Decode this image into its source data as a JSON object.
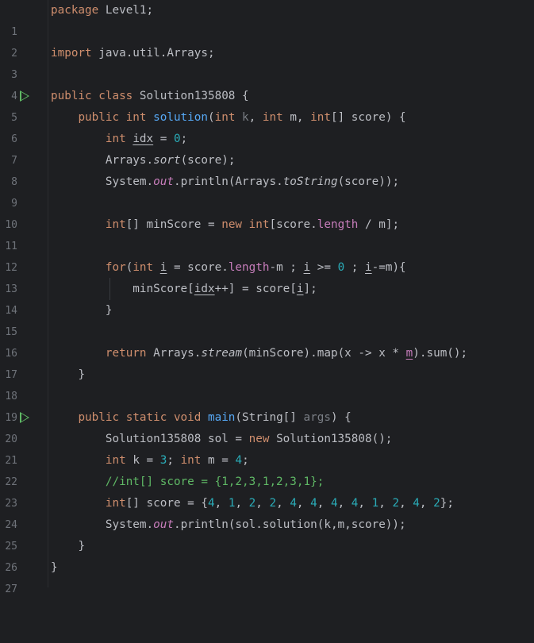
{
  "editor": {
    "lines": [
      {
        "n": "1"
      },
      {
        "n": "2"
      },
      {
        "n": "3"
      },
      {
        "n": "4"
      },
      {
        "n": "5"
      },
      {
        "n": "6"
      },
      {
        "n": "7"
      },
      {
        "n": "8"
      },
      {
        "n": "9"
      },
      {
        "n": "10"
      },
      {
        "n": "11"
      },
      {
        "n": "12"
      },
      {
        "n": "13"
      },
      {
        "n": "14"
      },
      {
        "n": "15"
      },
      {
        "n": "16"
      },
      {
        "n": "17"
      },
      {
        "n": "18"
      },
      {
        "n": "19"
      },
      {
        "n": "20"
      },
      {
        "n": "21"
      },
      {
        "n": "22"
      },
      {
        "n": "23"
      },
      {
        "n": "24"
      },
      {
        "n": "25"
      },
      {
        "n": "26"
      },
      {
        "n": "27"
      }
    ],
    "code": {
      "l1": {
        "kw": "package",
        "rest": " Level1;"
      },
      "l3": {
        "kw": "import",
        "rest": " java.util.Arrays;"
      },
      "l5": {
        "kw": "public class",
        "rest": " Solution135808 {"
      },
      "l6": {
        "kw1": "public int ",
        "fn": "solution",
        "p1": "(",
        "kw2": "int ",
        "p2": "k",
        ", ": "",
        "sep1": ", ",
        "kw3": "int ",
        "p3": "m, ",
        "kw4": "int",
        "p4": "[] score) {"
      },
      "l7": {
        "kw": "int ",
        "var": "idx",
        "eq": " = ",
        "num": "0",
        "end": ";"
      },
      "l8": {
        "a": "Arrays.",
        "m": "sort",
        "b": "(score);"
      },
      "l9": {
        "a": "System.",
        "f": "out",
        "b": ".println(Arrays.",
        "m": "toString",
        "c": "(score));"
      },
      "l11": {
        "kw": "int",
        "a": "[] minScore = ",
        "kw2": "new ",
        "kw3": "int",
        "b": "[score.",
        "f": "length",
        "c": " / m];"
      },
      "l13": {
        "kw": "for",
        "a": "(",
        "kw2": "int ",
        "v1": "i",
        "b": " = score.",
        "f": "length",
        "c": "-m ; ",
        "v2": "i",
        "d": " >= ",
        "num": "0",
        "e": " ; ",
        "v3": "i",
        "g": "-=m){"
      },
      "l14": {
        "a": "minScore[",
        "v1": "idx",
        "b": "++] = score[",
        "v2": "i",
        "c": "];"
      },
      "l15": {
        "a": "}"
      },
      "l17": {
        "kw": "return ",
        "a": "Arrays.",
        "m": "stream",
        "b": "(minScore).map(x -> x * ",
        "v": "m",
        "c": ").sum();"
      },
      "l18": {
        "a": "}"
      },
      "l20": {
        "kw": "public static void ",
        "fn": "main",
        "a": "(String[] ",
        "p": "args",
        "b": ") {"
      },
      "l21": {
        "a": "Solution135808 sol = ",
        "kw": "new ",
        "b": "Solution135808();"
      },
      "l22": {
        "kw1": "int ",
        "a": "k = ",
        "n1": "3",
        "b": "; ",
        "kw2": "int ",
        "c": "m = ",
        "n2": "4",
        "d": ";"
      },
      "l23": {
        "comment": "//int[] score = {1,2,3,1,2,3,1};"
      },
      "l24": {
        "kw": "int",
        "a": "[] score = {",
        "nums": [
          "4",
          "1",
          "2",
          "2",
          "4",
          "4",
          "4",
          "4",
          "1",
          "2",
          "4",
          "2"
        ],
        "sep": ", ",
        "b": "};"
      },
      "l25": {
        "a": "System.",
        "f": "out",
        "b": ".println(sol.solution(k,m,score));"
      },
      "l26": {
        "a": "}"
      },
      "l27": {
        "a": "}"
      }
    }
  },
  "colors": {
    "background": "#1e1f22",
    "keyword": "#cf8e6d",
    "function": "#56a8f5",
    "number": "#2aacb8",
    "field": "#c77dbb",
    "comment": "#5fb865",
    "run_icon": "#5fb865"
  }
}
